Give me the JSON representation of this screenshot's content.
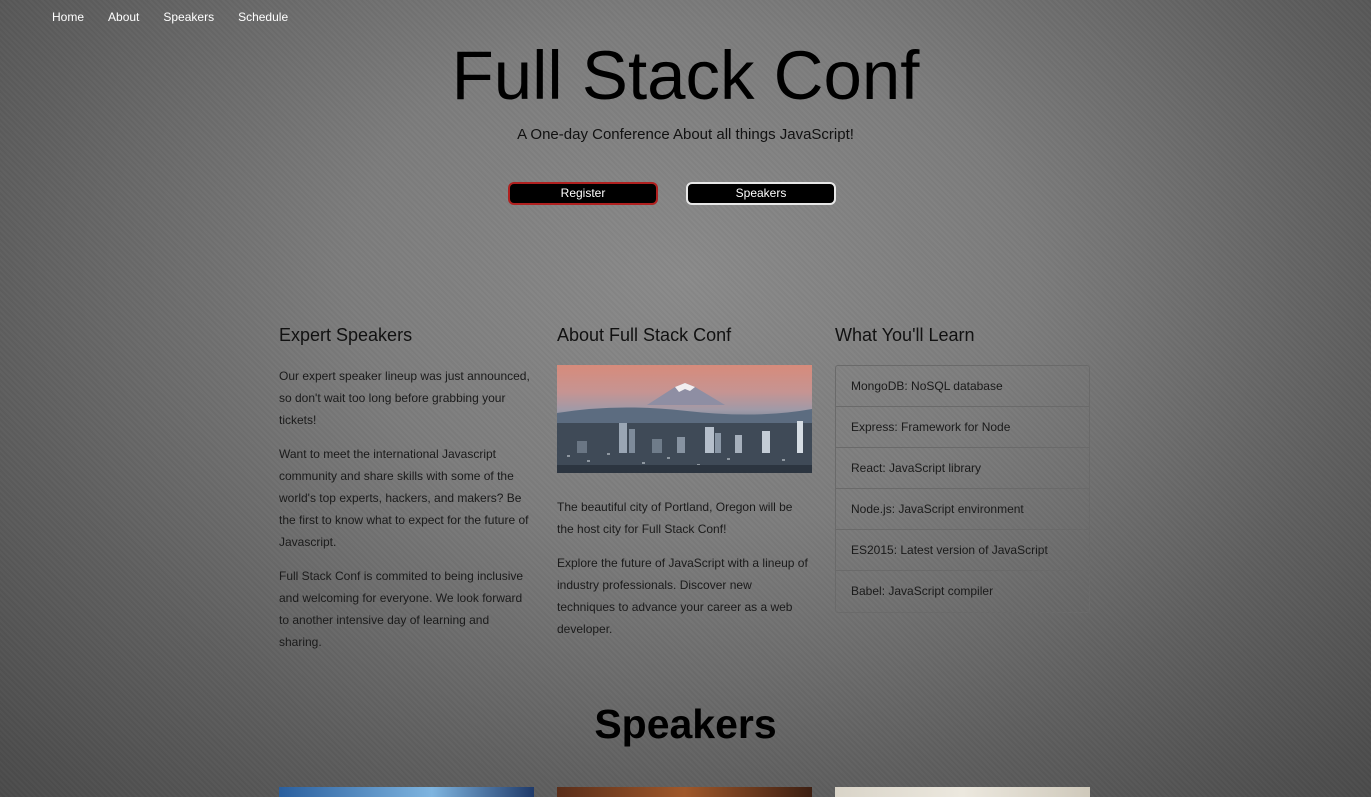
{
  "nav": {
    "items": [
      {
        "label": "Home"
      },
      {
        "label": "About"
      },
      {
        "label": "Speakers"
      },
      {
        "label": "Schedule"
      }
    ]
  },
  "hero": {
    "title": "Full Stack Conf",
    "subtitle": "A One-day Conference About all things JavaScript!",
    "register_label": "Register",
    "speakers_label": "Speakers",
    "colors": {
      "register_border": "#b0201f",
      "button_bg": "#000000"
    }
  },
  "expert": {
    "heading": "Expert Speakers",
    "paragraphs": [
      "Our expert speaker lineup was just announced, so don't wait too long before grabbing your tickets!",
      "Want to meet the international Javascript community and share skills with some of the world's top experts, hackers, and makers? Be the first to know what to expect for the future of Javascript.",
      "Full Stack Conf is commited to being inclusive and welcoming for everyone. We look forward to another intensive day of learning and sharing."
    ]
  },
  "about": {
    "heading": "About Full Stack Conf",
    "image": "portland-city-skyline-image",
    "paragraphs": [
      "The beautiful city of Portland, Oregon will be the host city for Full Stack Conf!",
      "Explore the future of JavaScript with a lineup of industry professionals. Discover new techniques to advance your career as a web developer."
    ]
  },
  "learn": {
    "heading": "What You'll Learn",
    "items": [
      "MongoDB: NoSQL database",
      "Express: Framework for Node",
      "React: JavaScript library",
      "Node.js: JavaScript environment",
      "ES2015: Latest version of JavaScript",
      "Babel: JavaScript compiler"
    ]
  },
  "speakers_section": {
    "heading": "Speakers",
    "cards": [
      "speaker-photo-1",
      "speaker-photo-2",
      "speaker-photo-3"
    ]
  }
}
